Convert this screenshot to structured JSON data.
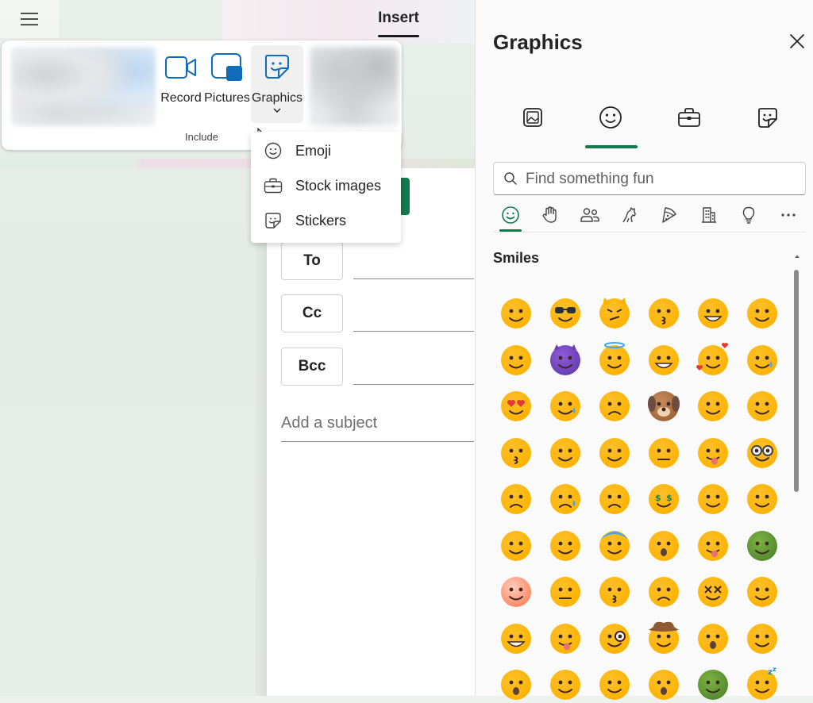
{
  "ribbon": {
    "active_tab": "Insert",
    "buttons": {
      "record": "Record",
      "pictures": "Pictures",
      "graphics": "Graphics"
    },
    "group_label": "Include"
  },
  "graphics_menu": {
    "items": [
      {
        "label": "Emoji",
        "icon": "smile-icon"
      },
      {
        "label": "Stock images",
        "icon": "briefcase-icon"
      },
      {
        "label": "Stickers",
        "icon": "sticker-icon"
      }
    ]
  },
  "compose": {
    "to_label": "To",
    "cc_label": "Cc",
    "bcc_label": "Bcc",
    "subject_placeholder": "Add a subject"
  },
  "pane": {
    "title": "Graphics",
    "tabs": [
      "image-icon",
      "smile-icon",
      "briefcase-icon",
      "sticker-icon"
    ],
    "active_tab": 1,
    "search_placeholder": "Find something fun",
    "categories": [
      "smile-icon",
      "hand-icon",
      "people-icon",
      "animal-icon",
      "food-icon",
      "building-icon",
      "lightbulb-icon",
      "more-icon"
    ],
    "active_category": 0,
    "section_title": "Smiles",
    "accent_color": "#0f7b4d"
  },
  "emoji_grid": [
    [
      "smiling-face",
      "sunglasses-face",
      "angry-cat",
      "kissing-face",
      "grinning-face",
      "smiling-eyes-face"
    ],
    [
      "slightly-smiling-face",
      "smiling-devil",
      "halo-face",
      "beaming-face",
      "hearts-face",
      "tear-face"
    ],
    [
      "heart-eyes-face",
      "sweat-smile-face",
      "disappointed-face",
      "dog-face",
      "weary-face",
      "relieved-face"
    ],
    [
      "kiss-heart-face",
      "pleading-face",
      "wink-face",
      "neutral-face",
      "tongue-face",
      "nerd-face"
    ],
    [
      "frowning-face",
      "crying-face",
      "anxious-face",
      "money-face",
      "upside-down-face",
      "shushing-face"
    ],
    [
      "salute-face",
      "smirk-face",
      "fearful-face",
      "open-mouth-face",
      "winking-tongue-face",
      "vomiting-face"
    ],
    [
      "dotted-face",
      "expressionless-face",
      "kissing-closed-eyes-face",
      "confused-face",
      "dizzy-face",
      "woozy-face"
    ],
    [
      "big-grin-face",
      "silly-tongue-face",
      "monocle-face",
      "cowboy-face",
      "astonished-face",
      "squinting-face"
    ],
    [
      "screaming-face",
      "pensive-face",
      "thinking-face",
      "hushed-face",
      "nauseated-face",
      "sleeping-face"
    ]
  ]
}
